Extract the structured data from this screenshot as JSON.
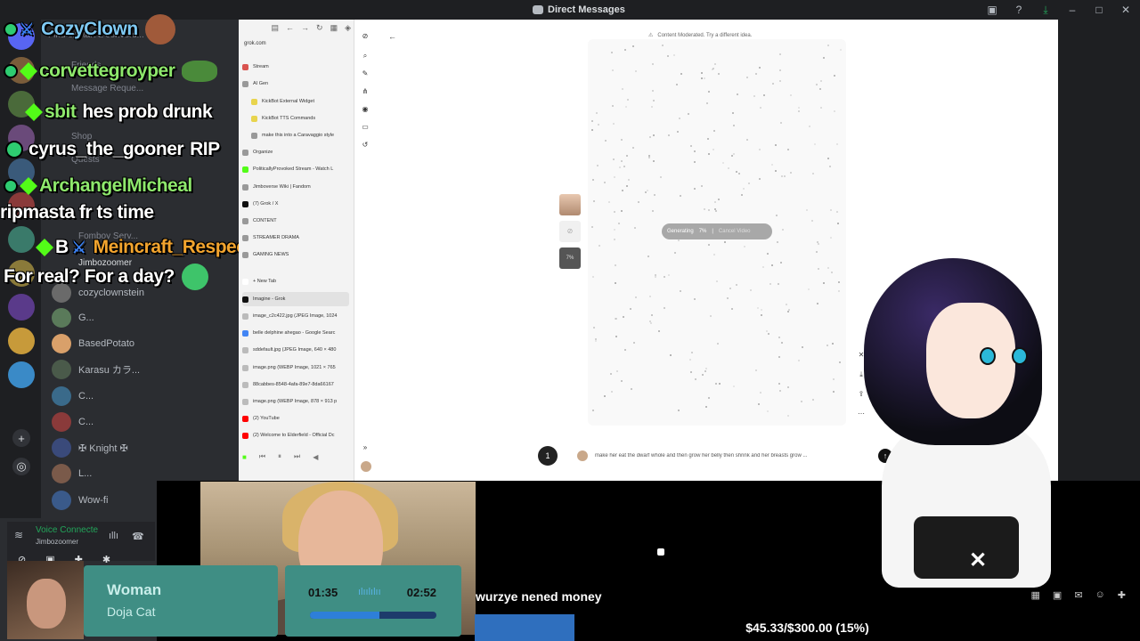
{
  "titlebar": {
    "title": "Direct Messages",
    "icons": [
      "inbox-icon",
      "help-icon",
      "download-icon",
      "minimize-icon",
      "maximize-icon",
      "close-icon"
    ]
  },
  "discord": {
    "ghost_items": [
      "Find or start a convers...",
      "Friends",
      "Message Reque...",
      "Shop",
      "Quests",
      "Fomboy Serv...",
      "Jimbozoomer"
    ],
    "dms": [
      "cozyclownstein",
      "G...",
      "BasedPotato",
      "Karasu カラ...",
      "C...",
      "C...",
      "✠ Knight ✠",
      "L...",
      "Wow-fi"
    ],
    "voice": {
      "status": "Voice Connecte",
      "channel": "Jimbozoomer"
    }
  },
  "chat": [
    {
      "user": "CozyClown",
      "msg": "",
      "color": "#7ec8f2"
    },
    {
      "user": "corvettegroyper",
      "msg": "",
      "color": "#8ee86c"
    },
    {
      "user": "sbit",
      "msg": "hes prob drunk",
      "color": "#8ee86c"
    },
    {
      "user": "cyrus_the_gooner",
      "msg": "RIP",
      "color": "#ffffff"
    },
    {
      "user": "ArchangelMicheal",
      "msg": "",
      "color": "#8ee86c"
    },
    {
      "user": "",
      "msg": "ripmasta fr ts time",
      "color": "#ffffff"
    },
    {
      "user": "Meincraft_Respector",
      "msg": "",
      "color": "#f2a42e"
    },
    {
      "user": "",
      "msg": "For real? For a day?",
      "color": "#ffffff"
    }
  ],
  "browser": {
    "url": "grok.com",
    "tabs": [
      {
        "label": "Stream",
        "color": "#d9534f"
      },
      {
        "label": "AI Gen",
        "color": "#999999"
      },
      {
        "label": "KickBot External Widget",
        "color": "#e8d44d"
      },
      {
        "label": "KickBot TTS Commands",
        "color": "#e8d44d"
      },
      {
        "label": "make this into a Caravaggio style",
        "color": "#999999"
      },
      {
        "label": "Organize",
        "color": "#999999"
      },
      {
        "label": "PoliticallyProvoked Stream - Watch L",
        "color": "#53fc18"
      },
      {
        "label": "Jimboverse Wiki | Fandom",
        "color": "#999999"
      },
      {
        "label": "(7) Grok / X",
        "color": "#111111"
      },
      {
        "label": "CONTENT",
        "color": "#999999"
      },
      {
        "label": "STREAMER DRAMA",
        "color": "#999999"
      },
      {
        "label": "GAMING NEWS",
        "color": "#999999"
      },
      {
        "label": "+ New Tab",
        "color": "#ffffff"
      },
      {
        "label": "Imagine - Grok",
        "color": "#111111"
      },
      {
        "label": "image_c2c422.jpg (JPEG Image, 1024",
        "color": "#bbbbbb"
      },
      {
        "label": "belle delphine ahegao - Google Searc",
        "color": "#4285f4"
      },
      {
        "label": "sddefault.jpg (JPEG Image, 640 × 480",
        "color": "#bbbbbb"
      },
      {
        "label": "image.png (WEBP Image, 1021 × 765",
        "color": "#bbbbbb"
      },
      {
        "label": "88cabbes-8548-4afa-89e7-8da66167",
        "color": "#bbbbbb"
      },
      {
        "label": "image.png (WEBP Image, 878 × 913 p",
        "color": "#bbbbbb"
      },
      {
        "label": "(2) YouTube",
        "color": "#ff0000"
      },
      {
        "label": "(2) Welcome to Elderfield - Official Dc",
        "color": "#ff0000"
      }
    ],
    "moderation_notice": "Content Moderated. Try a different idea.",
    "generating_label": "Generating",
    "generating_percent": "7%",
    "cancel_label": "Cancel Video",
    "thumb_percent": "7%",
    "prompt_text": "make her eat the dwarf whole and then grow her belly then shrink and her breasts grow ...",
    "mic_label": "1"
  },
  "music": {
    "song": "Woman",
    "artist": "Doja Cat",
    "elapsed": "01:35",
    "total": "02:52",
    "progress": 0.55
  },
  "donation": {
    "message": "wurzye nened money",
    "goal_label": "$45.33/$300.00 (15%)",
    "goal_fraction": 0.15
  },
  "colors": {
    "discord_bg": "#2b2d31",
    "music_panel": "#3f8e84",
    "goal_fill": "#2f6fbe"
  }
}
